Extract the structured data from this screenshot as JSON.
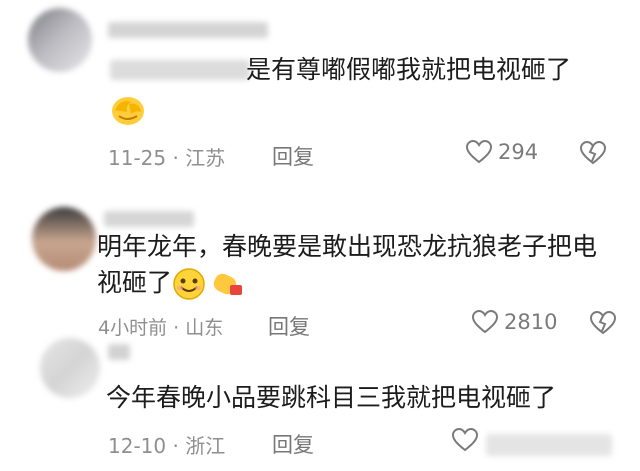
{
  "comments": [
    {
      "text": "是有尊嘟假嘟我就把电视砸了",
      "date": "11-25",
      "location": "江苏",
      "reply_label": "回复",
      "likes": "294"
    },
    {
      "text_line1": "明年龙年，春晚要是敢出现恐龙抗狼老子把电",
      "text_line2": "视砸了",
      "date": "4小时前",
      "location": "山东",
      "reply_label": "回复",
      "likes": "2810"
    },
    {
      "text": "今年春晚小品要跳科目三我就把电视砸了",
      "date": "12-10",
      "location": "浙江",
      "reply_label": "回复",
      "likes": ""
    }
  ],
  "separator": "·",
  "colors": {
    "text": "#1c1c1c",
    "meta": "#8f8f8f",
    "icon": "#7a7a7a",
    "background": "#ffffff"
  }
}
